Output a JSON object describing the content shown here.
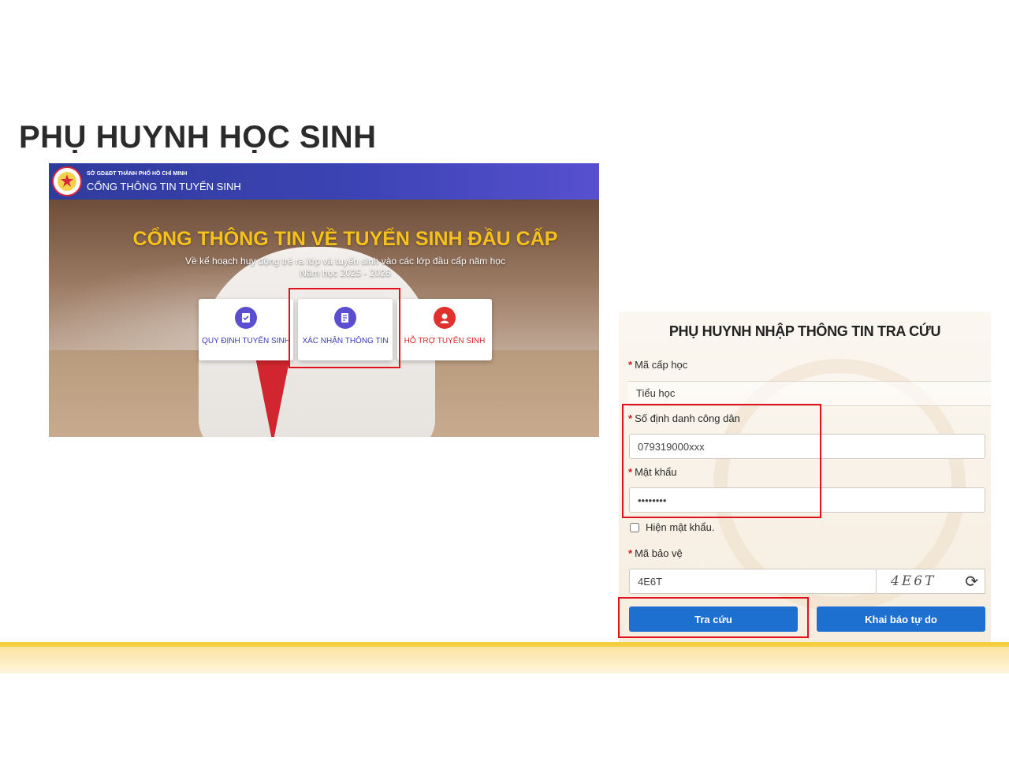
{
  "slide": {
    "title": "PHỤ HUYNH HỌC SINH"
  },
  "portal": {
    "department": "SỞ GD&ĐT THÀNH PHỐ HỒ CHÍ MINH",
    "name": "CỔNG THÔNG TIN TUYỂN SINH",
    "hero_title": "CỔNG THÔNG TIN VỀ TUYỂN SINH ĐẦU CẤP",
    "hero_subtitle_line1": "Về kế hoạch huy động trẻ ra lớp và tuyển sinh vào các lớp đầu cấp năm học",
    "hero_subtitle_line2": "Năm học 2025 - 2026",
    "cards": [
      {
        "label": "QUY ĐỊNH TUYỂN SINH",
        "icon": "clipboard-check-icon"
      },
      {
        "label": "XÁC NHẬN THÔNG TIN",
        "icon": "document-edit-icon"
      },
      {
        "label": "HỖ TRỢ TUYỂN SINH",
        "icon": "support-agent-icon"
      }
    ]
  },
  "form": {
    "title": "PHỤ HUYNH NHẬP THÔNG TIN TRA CỨU",
    "required_mark": "*",
    "level_label": "Mã cấp học",
    "level_value": "Tiểu học",
    "id_label": "Số định danh công dân",
    "id_value": "079319000xxx",
    "password_label": "Mật khẩu",
    "password_value": "••••••••",
    "show_password_label": "Hiện mật khẩu.",
    "captcha_label": "Mã bảo vệ",
    "captcha_value": "4E6T",
    "captcha_image_text": "4E6T",
    "search_button": "Tra cứu",
    "free_declare_button": "Khai báo tự do"
  },
  "colors": {
    "header_blue": "#3c43b4",
    "hero_title_yellow": "#f6c11a",
    "highlight_red": "#e0121b",
    "button_blue": "#1d6fd0",
    "band_yellow": "#f5cf3f"
  }
}
